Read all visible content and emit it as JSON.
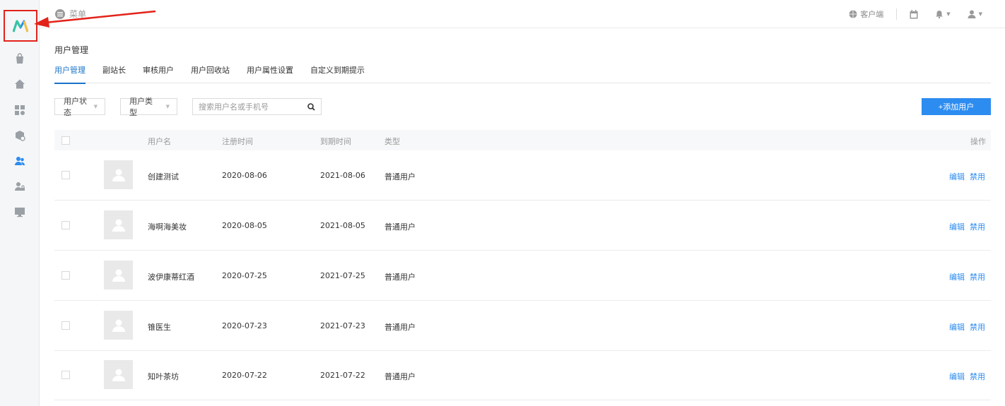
{
  "topbar": {
    "menu_label": "菜单",
    "client_label": "客户端"
  },
  "page": {
    "title": "用户管理",
    "tabs": [
      {
        "label": "用户管理",
        "active": true
      },
      {
        "label": "副站长",
        "active": false
      },
      {
        "label": "审核用户",
        "active": false
      },
      {
        "label": "用户回收站",
        "active": false
      },
      {
        "label": "用户属性设置",
        "active": false
      },
      {
        "label": "自定义到期提示",
        "active": false
      }
    ]
  },
  "filters": {
    "status_label": "用户状态",
    "type_label": "用户类型",
    "search_placeholder": "搜索用户名或手机号",
    "add_button": "+添加用户"
  },
  "table": {
    "headers": {
      "username": "用户名",
      "register_time": "注册时间",
      "expire_time": "到期时间",
      "type": "类型",
      "actions": "操作"
    },
    "rows": [
      {
        "username": "创建测试",
        "register": "2020-08-06",
        "expire": "2021-08-06",
        "type": "普通用户",
        "edit": "编辑",
        "disable": "禁用"
      },
      {
        "username": "海啊海美妆",
        "register": "2020-08-05",
        "expire": "2021-08-05",
        "type": "普通用户",
        "edit": "编辑",
        "disable": "禁用"
      },
      {
        "username": "波伊康蒂红酒",
        "register": "2020-07-25",
        "expire": "2021-07-25",
        "type": "普通用户",
        "edit": "编辑",
        "disable": "禁用"
      },
      {
        "username": "锥医生",
        "register": "2020-07-23",
        "expire": "2021-07-23",
        "type": "普通用户",
        "edit": "编辑",
        "disable": "禁用"
      },
      {
        "username": "知叶茶坊",
        "register": "2020-07-22",
        "expire": "2021-07-22",
        "type": "普通用户",
        "edit": "编辑",
        "disable": "禁用"
      }
    ]
  },
  "colors": {
    "accent": "#2d8cf0",
    "annotation": "#e2231a",
    "sidebar_bg": "#f5f6f7"
  }
}
